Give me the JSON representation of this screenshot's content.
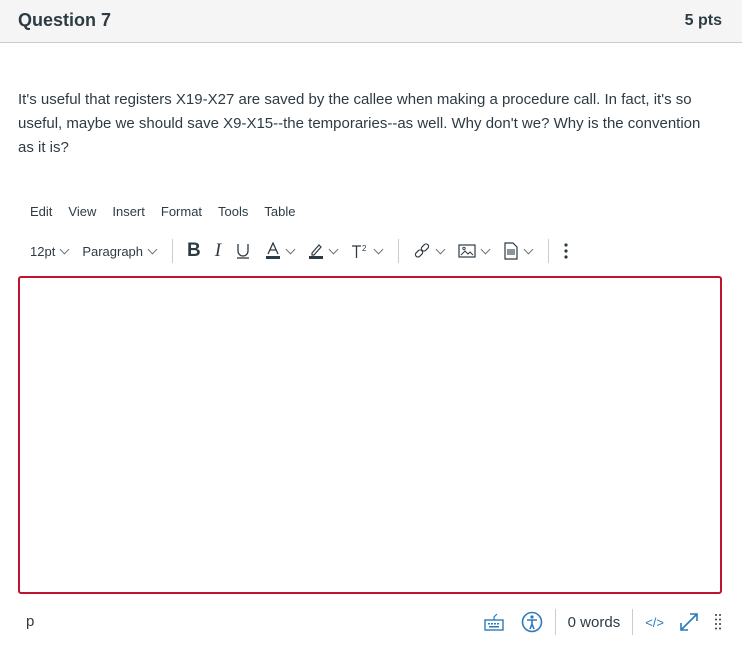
{
  "header": {
    "title": "Question 7",
    "points": "5 pts"
  },
  "question": {
    "text": "It's useful that registers X19-X27 are saved by the callee when making a procedure call. In fact, it's so useful, maybe we should save X9-X15--the temporaries--as well. Why don't we? Why is the convention as it is?"
  },
  "editor": {
    "menu": [
      "Edit",
      "View",
      "Insert",
      "Format",
      "Tools",
      "Table"
    ],
    "font_size": "12pt",
    "block_format": "Paragraph",
    "toolbar_icons": [
      "bold-icon",
      "italic-icon",
      "underline-icon",
      "text-color-icon",
      "highlight-icon",
      "superscript-icon",
      "link-icon",
      "image-icon",
      "document-icon",
      "more-icon"
    ],
    "body_value": "",
    "border_color": "#c0142e"
  },
  "statusbar": {
    "path": "p",
    "word_count": "0 words",
    "html_toggle": "</>",
    "icon_color": "#2b7abc"
  }
}
